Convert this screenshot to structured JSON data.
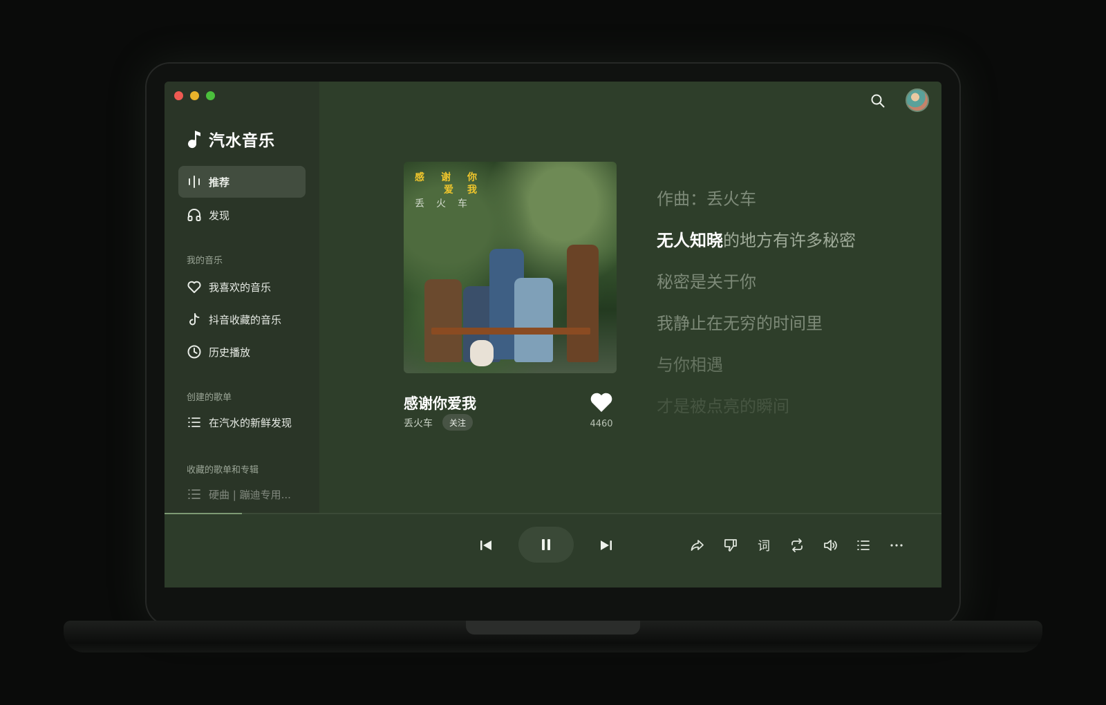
{
  "app": {
    "name": "汽水音乐"
  },
  "sidebar": {
    "nav": [
      {
        "label": "推荐",
        "icon": "waveform-icon",
        "active": true
      },
      {
        "label": "发现",
        "icon": "headphones-icon",
        "active": false
      }
    ],
    "my_music": {
      "label": "我的音乐",
      "items": [
        {
          "label": "我喜欢的音乐",
          "icon": "heart-icon"
        },
        {
          "label": "抖音收藏的音乐",
          "icon": "tiktok-icon"
        },
        {
          "label": "历史播放",
          "icon": "clock-icon"
        }
      ]
    },
    "created_playlists": {
      "label": "创建的歌单",
      "items": [
        {
          "label": "在汽水的新鲜发现",
          "icon": "list-icon"
        }
      ]
    },
    "saved_playlists": {
      "label": "收藏的歌单和专辑",
      "items": [
        {
          "label": "硬曲 | 蹦迪专用...",
          "icon": "list-icon"
        }
      ]
    }
  },
  "now_playing": {
    "album_cover_text": {
      "title_chars": [
        "感",
        "谢",
        "你",
        "爱",
        "我"
      ],
      "artist_chars": [
        "丢",
        "火",
        "车"
      ]
    },
    "title": "感谢你爱我",
    "artist": "丢火车",
    "follow_label": "关注",
    "like_count": "4460",
    "liked": true
  },
  "lyrics": {
    "lines": [
      {
        "before": "",
        "highlight": "",
        "after": "作曲：丢火车"
      },
      {
        "before": "",
        "highlight": "无人知晓",
        "after": "的地方有许多秘密"
      },
      {
        "before": "",
        "highlight": "",
        "after": "秘密是关于你"
      },
      {
        "before": "",
        "highlight": "",
        "after": "我静止在无穷的时间里"
      },
      {
        "before": "",
        "highlight": "",
        "after": "与你相遇"
      },
      {
        "before": "",
        "highlight": "",
        "after": "才是被点亮的瞬间"
      }
    ]
  },
  "player": {
    "progress_fraction": 0.1,
    "state": "playing",
    "controls": [
      "prev-icon",
      "pause-icon",
      "next-icon"
    ],
    "tools": [
      "share-icon",
      "dislike-icon",
      "lyrics-icon",
      "repeat-icon",
      "volume-icon",
      "playlist-icon",
      "more-icon"
    ],
    "lyrics_tool_label": "词"
  },
  "colors": {
    "background": "#2e3e2a",
    "sidebar": "#2a3527",
    "accent_yellow": "#f0c62c",
    "text_primary": "#ffffff"
  }
}
